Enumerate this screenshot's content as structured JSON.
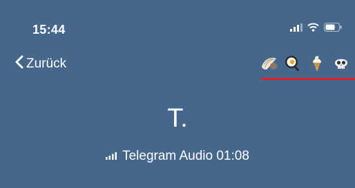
{
  "status_bar": {
    "time": "15:44",
    "icons": [
      "cellular-signal-icon",
      "wifi-icon",
      "battery-icon"
    ]
  },
  "nav": {
    "back_label": "Zurück",
    "encryption_emojis": [
      "shell-icon",
      "egg-in-pan-icon",
      "ice-cream-icon",
      "skull-icon"
    ],
    "accent_color": "#e0202b"
  },
  "call": {
    "peer_name": "T.",
    "status_text": "Telegram Audio 01:08",
    "signal_icon": "signal-strength-icon"
  },
  "colors": {
    "background": "#46678c",
    "text": "#ffffff"
  }
}
